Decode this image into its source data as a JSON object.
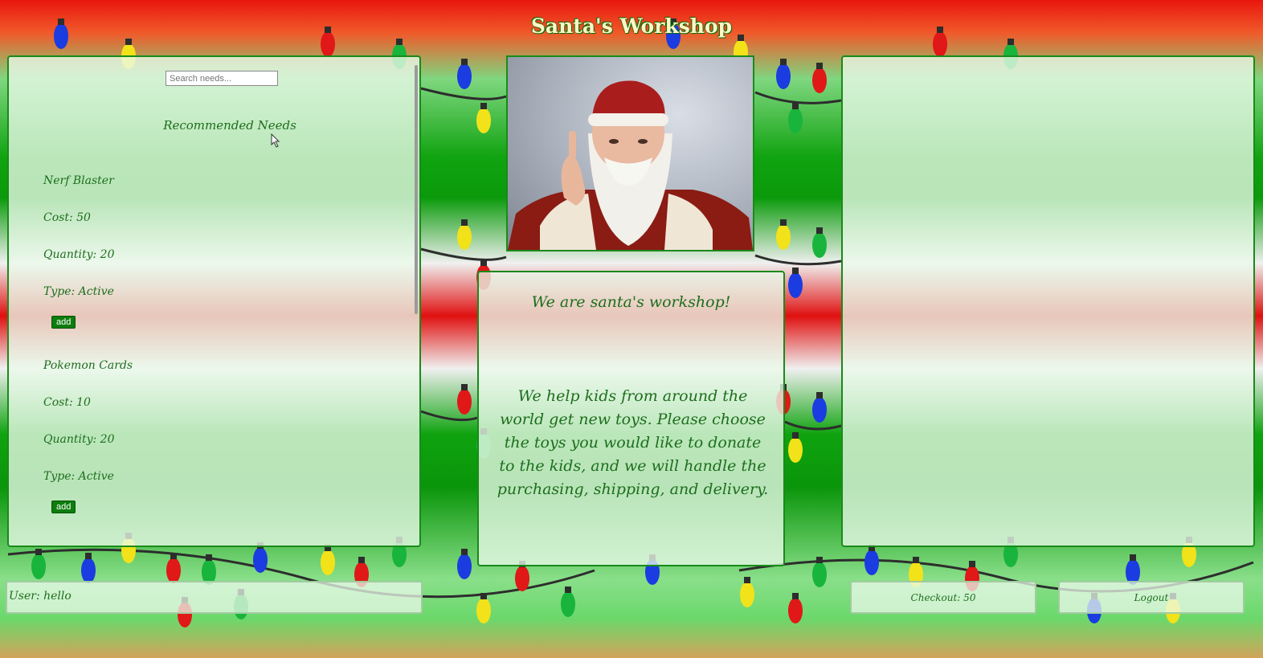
{
  "page": {
    "title": "Santa's Workshop"
  },
  "search": {
    "placeholder": "Search needs..."
  },
  "recommended": {
    "heading": "Recommended Needs",
    "items": [
      {
        "name": "Nerf Blaster",
        "cost": "Cost: 50",
        "quantity": "Quantity: 20",
        "type": "Type: Active",
        "add_label": "add"
      },
      {
        "name": "Pokemon Cards",
        "cost": "Cost: 10",
        "quantity": "Quantity: 20",
        "type": "Type: Active",
        "add_label": "add"
      }
    ]
  },
  "info": {
    "heading": "We are santa's workshop!",
    "body": "We help kids from around the world get new toys. Please choose the toys you would like to donate to the kids, and we will handle the purchasing, shipping, and delivery."
  },
  "footer": {
    "user": "User: hello",
    "checkout": "Checkout: 50",
    "logout": "Logout"
  },
  "colors": {
    "accent_green": "#1d6e1d",
    "button_green": "#0d7d0d",
    "title_text": "#fff6c8"
  }
}
